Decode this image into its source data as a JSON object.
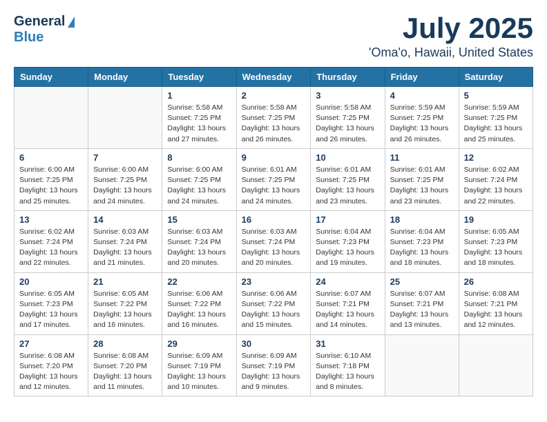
{
  "header": {
    "logo_general": "General",
    "logo_blue": "Blue",
    "month": "July 2025",
    "location": "'Oma'o, Hawaii, United States"
  },
  "weekdays": [
    "Sunday",
    "Monday",
    "Tuesday",
    "Wednesday",
    "Thursday",
    "Friday",
    "Saturday"
  ],
  "weeks": [
    [
      {
        "day": "",
        "info": ""
      },
      {
        "day": "",
        "info": ""
      },
      {
        "day": "1",
        "info": "Sunrise: 5:58 AM\nSunset: 7:25 PM\nDaylight: 13 hours and 27 minutes."
      },
      {
        "day": "2",
        "info": "Sunrise: 5:58 AM\nSunset: 7:25 PM\nDaylight: 13 hours and 26 minutes."
      },
      {
        "day": "3",
        "info": "Sunrise: 5:58 AM\nSunset: 7:25 PM\nDaylight: 13 hours and 26 minutes."
      },
      {
        "day": "4",
        "info": "Sunrise: 5:59 AM\nSunset: 7:25 PM\nDaylight: 13 hours and 26 minutes."
      },
      {
        "day": "5",
        "info": "Sunrise: 5:59 AM\nSunset: 7:25 PM\nDaylight: 13 hours and 25 minutes."
      }
    ],
    [
      {
        "day": "6",
        "info": "Sunrise: 6:00 AM\nSunset: 7:25 PM\nDaylight: 13 hours and 25 minutes."
      },
      {
        "day": "7",
        "info": "Sunrise: 6:00 AM\nSunset: 7:25 PM\nDaylight: 13 hours and 24 minutes."
      },
      {
        "day": "8",
        "info": "Sunrise: 6:00 AM\nSunset: 7:25 PM\nDaylight: 13 hours and 24 minutes."
      },
      {
        "day": "9",
        "info": "Sunrise: 6:01 AM\nSunset: 7:25 PM\nDaylight: 13 hours and 24 minutes."
      },
      {
        "day": "10",
        "info": "Sunrise: 6:01 AM\nSunset: 7:25 PM\nDaylight: 13 hours and 23 minutes."
      },
      {
        "day": "11",
        "info": "Sunrise: 6:01 AM\nSunset: 7:25 PM\nDaylight: 13 hours and 23 minutes."
      },
      {
        "day": "12",
        "info": "Sunrise: 6:02 AM\nSunset: 7:24 PM\nDaylight: 13 hours and 22 minutes."
      }
    ],
    [
      {
        "day": "13",
        "info": "Sunrise: 6:02 AM\nSunset: 7:24 PM\nDaylight: 13 hours and 22 minutes."
      },
      {
        "day": "14",
        "info": "Sunrise: 6:03 AM\nSunset: 7:24 PM\nDaylight: 13 hours and 21 minutes."
      },
      {
        "day": "15",
        "info": "Sunrise: 6:03 AM\nSunset: 7:24 PM\nDaylight: 13 hours and 20 minutes."
      },
      {
        "day": "16",
        "info": "Sunrise: 6:03 AM\nSunset: 7:24 PM\nDaylight: 13 hours and 20 minutes."
      },
      {
        "day": "17",
        "info": "Sunrise: 6:04 AM\nSunset: 7:23 PM\nDaylight: 13 hours and 19 minutes."
      },
      {
        "day": "18",
        "info": "Sunrise: 6:04 AM\nSunset: 7:23 PM\nDaylight: 13 hours and 18 minutes."
      },
      {
        "day": "19",
        "info": "Sunrise: 6:05 AM\nSunset: 7:23 PM\nDaylight: 13 hours and 18 minutes."
      }
    ],
    [
      {
        "day": "20",
        "info": "Sunrise: 6:05 AM\nSunset: 7:23 PM\nDaylight: 13 hours and 17 minutes."
      },
      {
        "day": "21",
        "info": "Sunrise: 6:05 AM\nSunset: 7:22 PM\nDaylight: 13 hours and 16 minutes."
      },
      {
        "day": "22",
        "info": "Sunrise: 6:06 AM\nSunset: 7:22 PM\nDaylight: 13 hours and 16 minutes."
      },
      {
        "day": "23",
        "info": "Sunrise: 6:06 AM\nSunset: 7:22 PM\nDaylight: 13 hours and 15 minutes."
      },
      {
        "day": "24",
        "info": "Sunrise: 6:07 AM\nSunset: 7:21 PM\nDaylight: 13 hours and 14 minutes."
      },
      {
        "day": "25",
        "info": "Sunrise: 6:07 AM\nSunset: 7:21 PM\nDaylight: 13 hours and 13 minutes."
      },
      {
        "day": "26",
        "info": "Sunrise: 6:08 AM\nSunset: 7:21 PM\nDaylight: 13 hours and 12 minutes."
      }
    ],
    [
      {
        "day": "27",
        "info": "Sunrise: 6:08 AM\nSunset: 7:20 PM\nDaylight: 13 hours and 12 minutes."
      },
      {
        "day": "28",
        "info": "Sunrise: 6:08 AM\nSunset: 7:20 PM\nDaylight: 13 hours and 11 minutes."
      },
      {
        "day": "29",
        "info": "Sunrise: 6:09 AM\nSunset: 7:19 PM\nDaylight: 13 hours and 10 minutes."
      },
      {
        "day": "30",
        "info": "Sunrise: 6:09 AM\nSunset: 7:19 PM\nDaylight: 13 hours and 9 minutes."
      },
      {
        "day": "31",
        "info": "Sunrise: 6:10 AM\nSunset: 7:18 PM\nDaylight: 13 hours and 8 minutes."
      },
      {
        "day": "",
        "info": ""
      },
      {
        "day": "",
        "info": ""
      }
    ]
  ]
}
